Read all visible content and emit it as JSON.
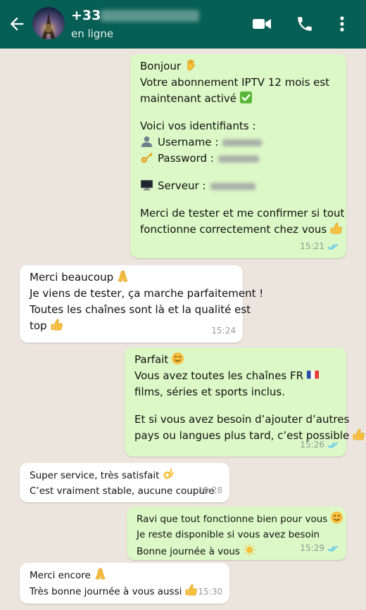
{
  "header": {
    "contact_number": "+33",
    "status": "en ligne"
  },
  "messages": [
    {
      "lines": [
        "Bonjour",
        "Votre abonnement IPTV 12 mois est",
        "maintenant activé",
        "Voici vos identifiants :",
        "Username :",
        "Password :",
        "Serveur :",
        "Merci de tester et me confirmer si tout",
        "fonctionne correctement chez vous"
      ],
      "time": "15:21"
    },
    {
      "lines": [
        "Merci beaucoup",
        "Je viens de tester, ça marche parfaitement !",
        "Toutes les chaînes sont là et la qualité est",
        "top"
      ],
      "time": "15:24"
    },
    {
      "lines": [
        "Parfait",
        "Vous avez toutes les chaînes FR",
        "films, séries et sports inclus.",
        "Et si vous avez besoin d’ajouter d’autres",
        "pays ou langues plus tard, c’est possible"
      ],
      "time": "15:26"
    },
    {
      "lines": [
        "Super service, très satisfait",
        "C’est vraiment stable, aucune coupure"
      ],
      "time": "15:28"
    },
    {
      "lines": [
        "Ravi que tout fonctionne bien pour vous",
        "Je reste disponible si vous avez besoin",
        "Bonne journée à vous"
      ],
      "time": "15:29"
    },
    {
      "lines": [
        "Merci encore",
        "Très bonne journée à vous aussi"
      ],
      "time": "15:30"
    }
  ],
  "icons": {
    "back": "arrow-left",
    "video_call": "video-camera",
    "voice_call": "phone",
    "menu": "vertical-dots",
    "read_receipt": "double-check-blue"
  },
  "colors": {
    "header": "#075e54",
    "outgoing_bubble": "#dcf8c6",
    "incoming_bubble": "#ffffff",
    "chat_background": "#ece5dd",
    "read_tick": "#4fc3f7"
  }
}
